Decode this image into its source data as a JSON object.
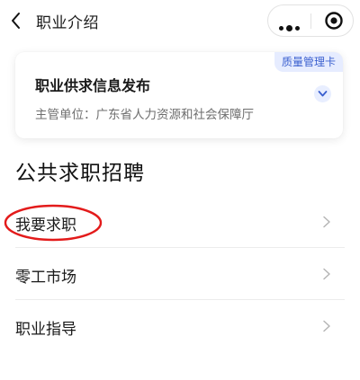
{
  "nav": {
    "title": "职业介绍",
    "back_icon": "chevron-left-icon",
    "more_icon": "more-dots-icon",
    "close_icon": "target-close-icon"
  },
  "card": {
    "badge": "质量管理卡",
    "title": "职业供求信息发布",
    "subtitle": "主管单位：广东省人力资源和社会保障厅",
    "expand_icon": "chevron-down-icon"
  },
  "section": {
    "title": "公共求职招聘"
  },
  "menu": {
    "items": [
      {
        "label": "我要求职"
      },
      {
        "label": "零工市场"
      },
      {
        "label": "职业指导"
      }
    ]
  },
  "colors": {
    "accent": "#3a5fcf",
    "badge_bg": "#e6ecff",
    "highlight": "#e31b1b"
  }
}
